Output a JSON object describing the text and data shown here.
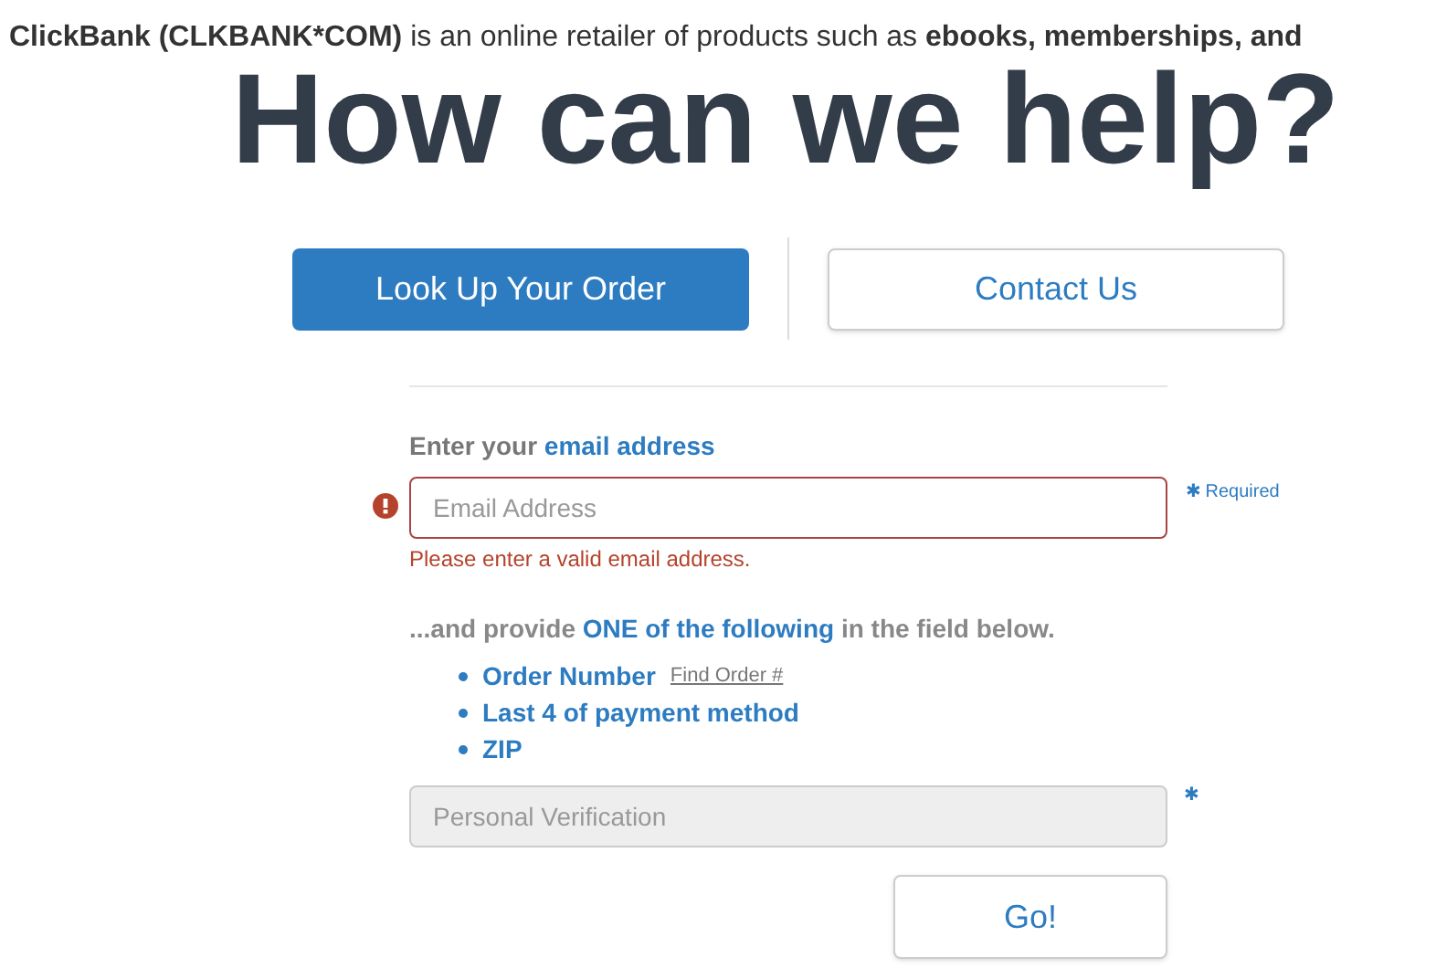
{
  "intro": "**ClickBank (CLKBANK*COM)** is an online retailer of products such as **ebooks, memberships, and**",
  "heading": "How can we help?",
  "tabs": [
    {
      "label": "Look Up Your Order",
      "selected": true
    },
    {
      "label": "Contact Us",
      "selected": false
    }
  ],
  "email": {
    "label": "Enter your **email address**",
    "placeholder": "Email Address",
    "required": "✱ Required",
    "error": "Please enter a valid email address.",
    "invalid": true
  },
  "instructions": "...and provide **ONE of the following** in the field below.",
  "options": [
    {
      "label": "Order Number",
      "link": "Find Order #"
    },
    {
      "label": "Last 4 of payment method"
    },
    {
      "label": "ZIP"
    }
  ],
  "verification": {
    "placeholder": "Personal Verification",
    "required_mark": "✱",
    "disabled": true
  },
  "submit": "Go!"
}
